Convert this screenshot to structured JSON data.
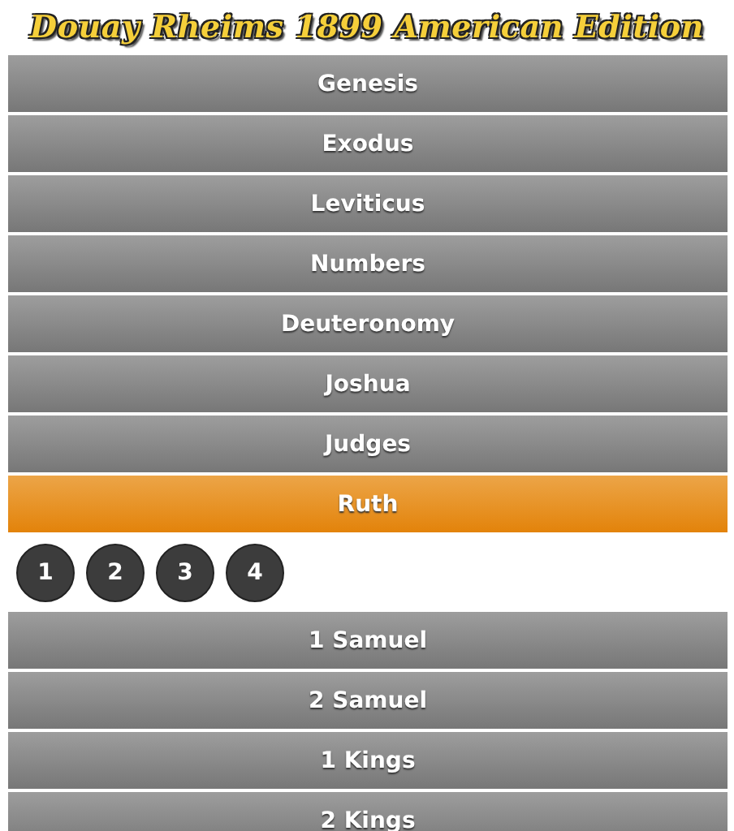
{
  "title": "Douay Rheims 1899 American Edition",
  "books": [
    {
      "name": "Genesis",
      "selected": false
    },
    {
      "name": "Exodus",
      "selected": false
    },
    {
      "name": "Leviticus",
      "selected": false
    },
    {
      "name": "Numbers",
      "selected": false
    },
    {
      "name": "Deuteronomy",
      "selected": false
    },
    {
      "name": "Joshua",
      "selected": false
    },
    {
      "name": "Judges",
      "selected": false
    },
    {
      "name": "Ruth",
      "selected": true,
      "chapters": [
        "1",
        "2",
        "3",
        "4"
      ]
    },
    {
      "name": "1 Samuel",
      "selected": false
    },
    {
      "name": "2 Samuel",
      "selected": false
    },
    {
      "name": "1 Kings",
      "selected": false
    },
    {
      "name": "2 Kings",
      "selected": false
    }
  ]
}
